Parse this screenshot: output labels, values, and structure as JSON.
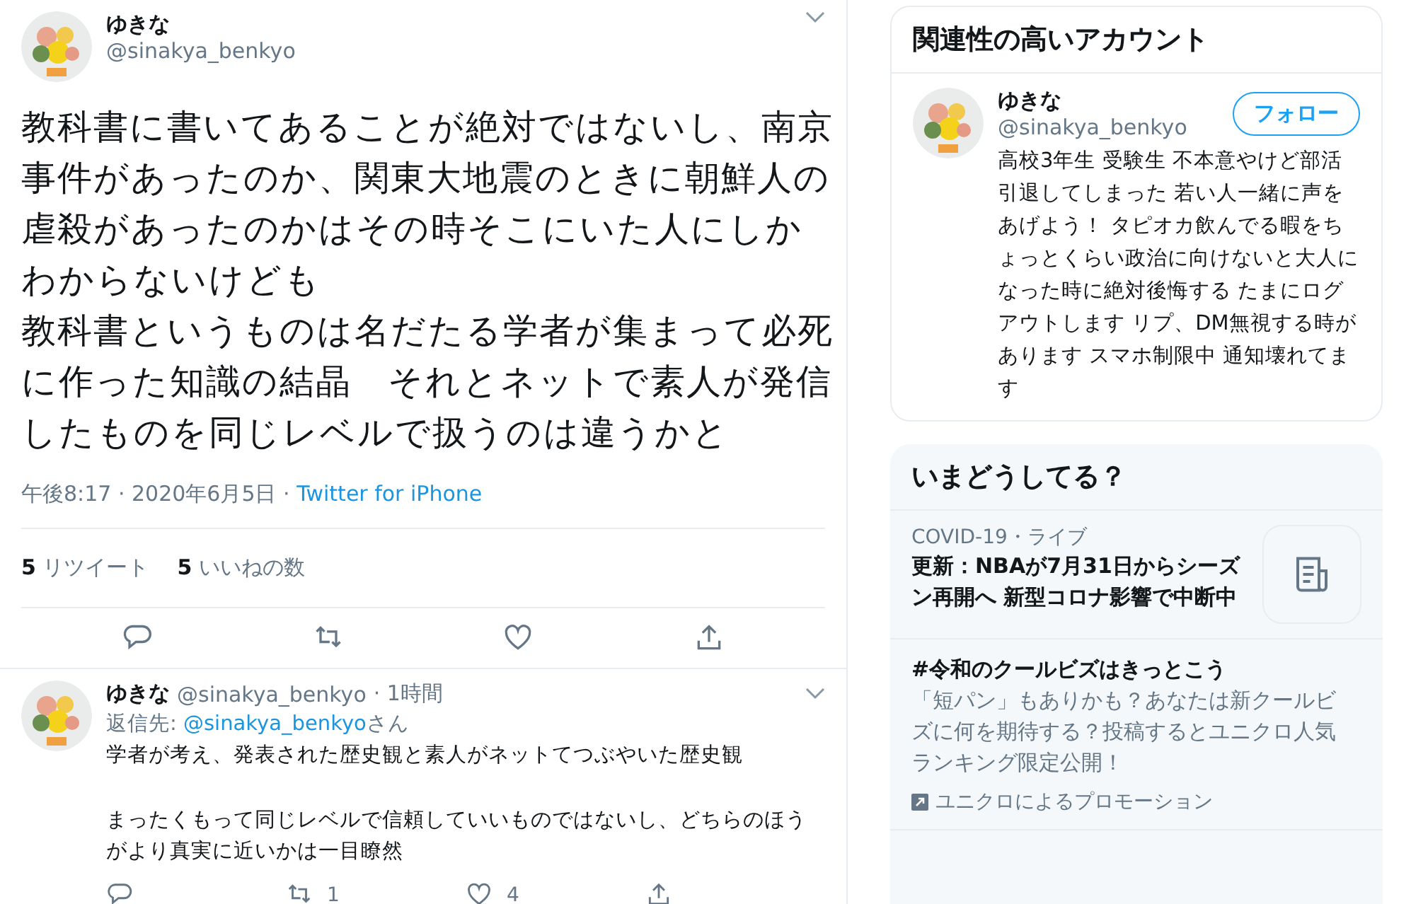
{
  "main_tweet": {
    "name": "ゆきな",
    "handle": "@sinakya_benkyo",
    "paragraphs": [
      "教科書に書いてあることが絶対ではないし、南京事件があったのか、関東大地震のときに朝鮮人の虐殺があったのかはその時そこにいた人にしかわからないけども",
      "教科書というものは名だたる学者が集まって必死に作った知識の結晶　それとネットで素人が発信したものを同じレベルで扱うのは違うかと"
    ],
    "time": "午後8:17 · 2020年6月5日 · ",
    "source": "Twitter for iPhone",
    "stats": [
      {
        "count": "5",
        "label": "リツイート"
      },
      {
        "count": "5",
        "label": "いいねの数"
      }
    ]
  },
  "reply": {
    "name": "ゆきな",
    "handle": "@sinakya_benkyo",
    "age": "· 1時間",
    "reply_to_label": "返信先: ",
    "reply_to": "@sinakya_benkyo",
    "reply_to_suffix": "さん",
    "paragraphs": [
      "学者が考え、発表された歴史観と素人がネットてつぶやいた歴史観",
      "まったくもって同じレベルで信頼していいものではないし、どちらのほうがより真実に近いかは一目瞭然"
    ],
    "retweets": "1",
    "likes": "4"
  },
  "related": {
    "title": "関連性の高いアカウント",
    "name": "ゆきな",
    "handle": "@sinakya_benkyo",
    "follow_button": "フォロー",
    "bio": "高校3年生 受験生 不本意やけど部活引退してしまった 若い人一緒に声をあげよう！ タピオカ飲んでる暇をちょっとくらい政治に向けないと大人になった時に絶対後悔する たまにログアウトします リプ、DM無視する時があります スマホ制限中 通知壊れてます"
  },
  "trends": {
    "title": "いまどうしてる？",
    "items": [
      {
        "kind": "news",
        "context": "COVID-19・ライブ",
        "headline": "更新：NBAが7月31日からシーズン再開へ 新型コロナ影響で中断中"
      },
      {
        "kind": "promoted",
        "headline": "#令和のクールビズはきっとこう",
        "description": "「短パン」もありかも？あなたは新クールビズに何を期待する？投稿するとユニクロ人気ランキング限定公開！",
        "promoter": "ユニクロによるプロモーション"
      }
    ]
  }
}
